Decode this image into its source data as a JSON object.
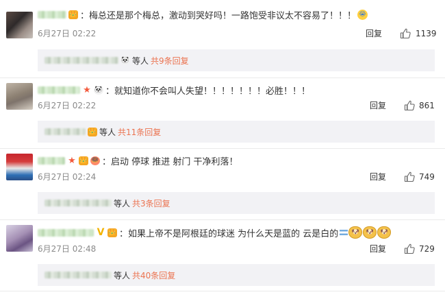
{
  "comments": [
    {
      "text": "：梅总还是那个梅总，激动到哭好吗！一路饱受非议太不容易了！！！",
      "date": "6月27日",
      "time": "02:22",
      "reply_label": "回复",
      "likes": "1139",
      "sub_who": "等人",
      "sub_more": "共9条回复"
    },
    {
      "text": "：就知道你不会叫人失望！！！！！！！必胜！！！",
      "date": "6月27日",
      "time": "02:22",
      "reply_label": "回复",
      "likes": "861",
      "sub_who": "等人",
      "sub_more": "共11条回复"
    },
    {
      "text": "：启动 停球 推进 射门 干净利落！",
      "date": "6月27日",
      "time": "02:24",
      "reply_label": "回复",
      "likes": "749",
      "sub_who": "等人",
      "sub_more": "共3条回复"
    },
    {
      "text": "：如果上帝不是阿根廷的球迷 为什么天是蓝的 云是白的",
      "date": "6月27日",
      "time": "02:48",
      "reply_label": "回复",
      "likes": "729",
      "sub_who": "等人",
      "sub_more": "共40条回复"
    }
  ],
  "icons": {
    "like": "thumbs-up-outline-icon",
    "vip": "vip-crown-icon",
    "cry": "crying-face-emoji",
    "dog": "doge-emoji",
    "flag": "argentina-flag-emoji"
  },
  "colors": {
    "more_link": "#eb7350",
    "subbox_bg": "#f2f2f5",
    "meta_text": "#8a8a8a"
  }
}
